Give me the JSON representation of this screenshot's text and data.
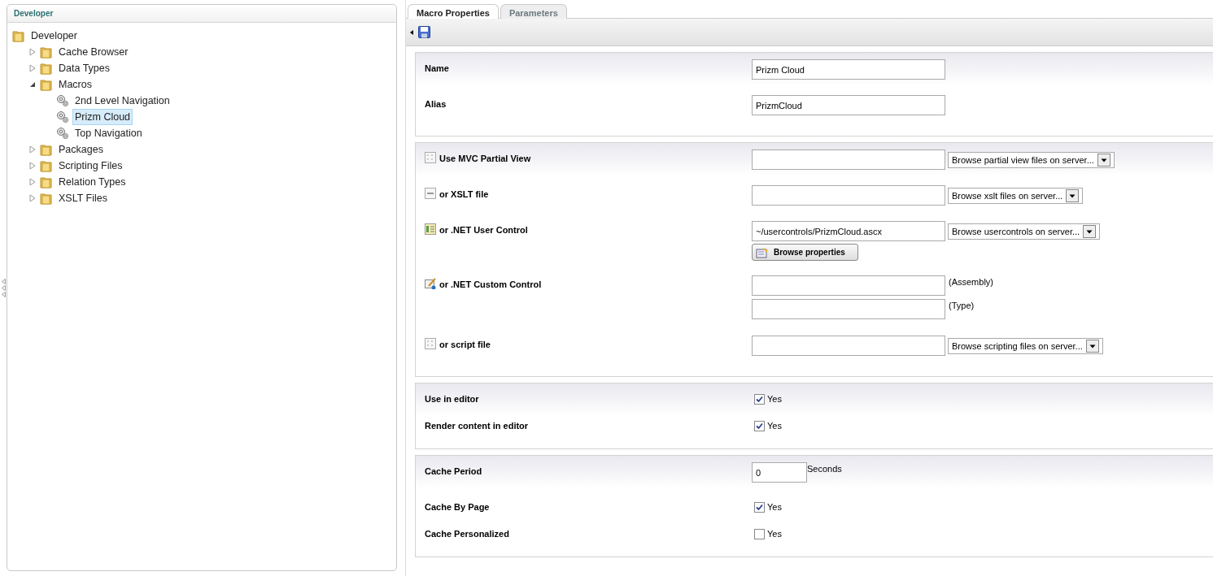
{
  "tree": {
    "title": "Developer",
    "root": {
      "label": "Developer",
      "kind": "folder",
      "selected": false,
      "children": [
        {
          "label": "Cache Browser",
          "kind": "folder",
          "expanded": false,
          "selected": false
        },
        {
          "label": "Data Types",
          "kind": "folder",
          "expanded": false,
          "selected": false
        },
        {
          "label": "Macros",
          "kind": "folder",
          "expanded": true,
          "selected": false,
          "children": [
            {
              "label": "2nd Level Navigation",
              "kind": "macro",
              "selected": false
            },
            {
              "label": "Prizm Cloud",
              "kind": "macro",
              "selected": true
            },
            {
              "label": "Top Navigation",
              "kind": "macro",
              "selected": false
            }
          ]
        },
        {
          "label": "Packages",
          "kind": "folder",
          "expanded": false,
          "selected": false
        },
        {
          "label": "Scripting Files",
          "kind": "folder",
          "expanded": false,
          "selected": false
        },
        {
          "label": "Relation Types",
          "kind": "folder",
          "expanded": false,
          "selected": false
        },
        {
          "label": "XSLT Files",
          "kind": "folder",
          "expanded": false,
          "selected": false
        }
      ]
    }
  },
  "tabs": [
    {
      "label": "Macro Properties",
      "selected": true
    },
    {
      "label": "Parameters",
      "selected": false
    }
  ],
  "sections": [
    {
      "rows": [
        {
          "kind": "text",
          "label": "Name",
          "value": "Prizm Cloud"
        },
        {
          "kind": "text",
          "label": "Alias",
          "value": "PrizmCloud"
        }
      ]
    },
    {
      "rows": [
        {
          "kind": "mvc",
          "label": "Use MVC Partial View",
          "select": "Browse partial view files on server..."
        },
        {
          "kind": "xslt",
          "label": "or XSLT file",
          "select": "Browse xslt files on server..."
        },
        {
          "kind": "usercontrol",
          "label": "or .NET User Control",
          "value": "~/usercontrols/PrizmCloud.ascx",
          "select": "Browse usercontrols on server...",
          "button": "Browse properties"
        },
        {
          "kind": "customcontrol",
          "label": "or .NET Custom Control",
          "fields": [
            {
              "suffix": "(Assembly)"
            },
            {
              "suffix": "(Type)"
            }
          ]
        },
        {
          "kind": "script",
          "label": "or script file",
          "select": "Browse scripting files on server..."
        }
      ]
    },
    {
      "rows": [
        {
          "kind": "checkbox",
          "label": "Use in editor",
          "checked": true,
          "option": "Yes"
        },
        {
          "kind": "checkbox",
          "label": "Render content in editor",
          "checked": true,
          "option": "Yes"
        }
      ]
    },
    {
      "rows": [
        {
          "kind": "number",
          "label": "Cache Period",
          "value": "0",
          "unit": "Seconds"
        },
        {
          "kind": "checkbox",
          "label": "Cache By Page",
          "checked": true,
          "option": "Yes"
        },
        {
          "kind": "checkbox",
          "label": "Cache Personalized",
          "checked": false,
          "option": "Yes"
        }
      ]
    }
  ]
}
